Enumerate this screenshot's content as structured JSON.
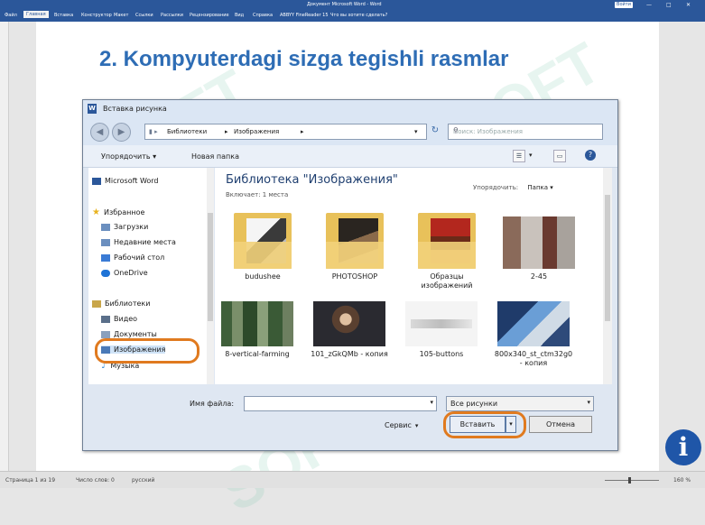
{
  "window": {
    "title": "Документ Microsoft Word - Word",
    "share_label": "Войти",
    "controls": [
      "—",
      "□",
      "✕"
    ]
  },
  "ribbon": {
    "tabs": [
      "Файл",
      "Главная",
      "Вставка",
      "Конструктор",
      "Макет",
      "Ссылки",
      "Рассылки",
      "Рецензирование",
      "Вид",
      "Справка",
      "ABBYY FineReader 15",
      "Что вы хотите сделать?"
    ],
    "active_index": 1
  },
  "document": {
    "heading": "2. Kompyuterdagi sizga tegishli rasmlar"
  },
  "dialog": {
    "title": "Вставка рисунка",
    "address": [
      "Библиотеки",
      "Изображения"
    ],
    "search_placeholder": "Поиск: Изображения",
    "toolbar": {
      "organize": "Упорядочить ▾",
      "new_folder": "Новая папка"
    },
    "nav": {
      "items": [
        {
          "label": "Microsoft Word",
          "icon": "word-icon",
          "color": "#2b579a"
        },
        {
          "label": "Избранное",
          "icon": "star-icon",
          "color": "#e8b320"
        },
        {
          "label": "Загрузки",
          "icon": "downloads-icon",
          "color": "#6b8fbf"
        },
        {
          "label": "Недавние места",
          "icon": "recent-places-icon",
          "color": "#6b8fbf"
        },
        {
          "label": "Рабочий стол",
          "icon": "desktop-icon",
          "color": "#3a7bd5"
        },
        {
          "label": "OneDrive",
          "icon": "onedrive-icon",
          "color": "#1e73d6"
        },
        {
          "label": "Библиотеки",
          "icon": "libraries-icon",
          "color": "#c9a64a"
        },
        {
          "label": "Видео",
          "icon": "video-icon",
          "color": "#5a6f8a"
        },
        {
          "label": "Документы",
          "icon": "documents-icon",
          "color": "#8aa0bd"
        },
        {
          "label": "Изображения",
          "icon": "pictures-icon",
          "color": "#4a7ab8"
        },
        {
          "label": "Музыка",
          "icon": "music-icon",
          "color": "#3a8fd8"
        }
      ]
    },
    "library": {
      "title": "Библиотека \"Изображения\"",
      "subtitle": "Включает:  1 места",
      "arrange_label": "Упорядочить:",
      "arrange_value": "Папка ▾"
    },
    "files": [
      {
        "name": "budushee",
        "kind": "folder"
      },
      {
        "name": "PHOTOSHOP",
        "kind": "folder"
      },
      {
        "name": "Образцы изображений",
        "kind": "folder"
      },
      {
        "name": "2-45",
        "kind": "image"
      },
      {
        "name": "8-vertical-farming",
        "kind": "image"
      },
      {
        "name": "101_zGkQMb - копия",
        "kind": "image"
      },
      {
        "name": "105-buttons",
        "kind": "image"
      },
      {
        "name": "800x340_st_ctm32g0 - копия",
        "kind": "image"
      }
    ],
    "filename_label": "Имя файла:",
    "filename_value": "",
    "filetype_value": "Все рисунки",
    "service_label": "Сервис",
    "insert_label": "Вставить",
    "cancel_label": "Отмена"
  },
  "statusbar": {
    "page": "Страница 1 из 19",
    "words": "Число слов: 0",
    "language": "русский",
    "zoom": "160 %"
  },
  "watermark": "SOFT",
  "info_label": "i",
  "colors": {
    "word_blue": "#2b579a",
    "heading": "#2e6db5",
    "highlight": "#e07a1f"
  }
}
